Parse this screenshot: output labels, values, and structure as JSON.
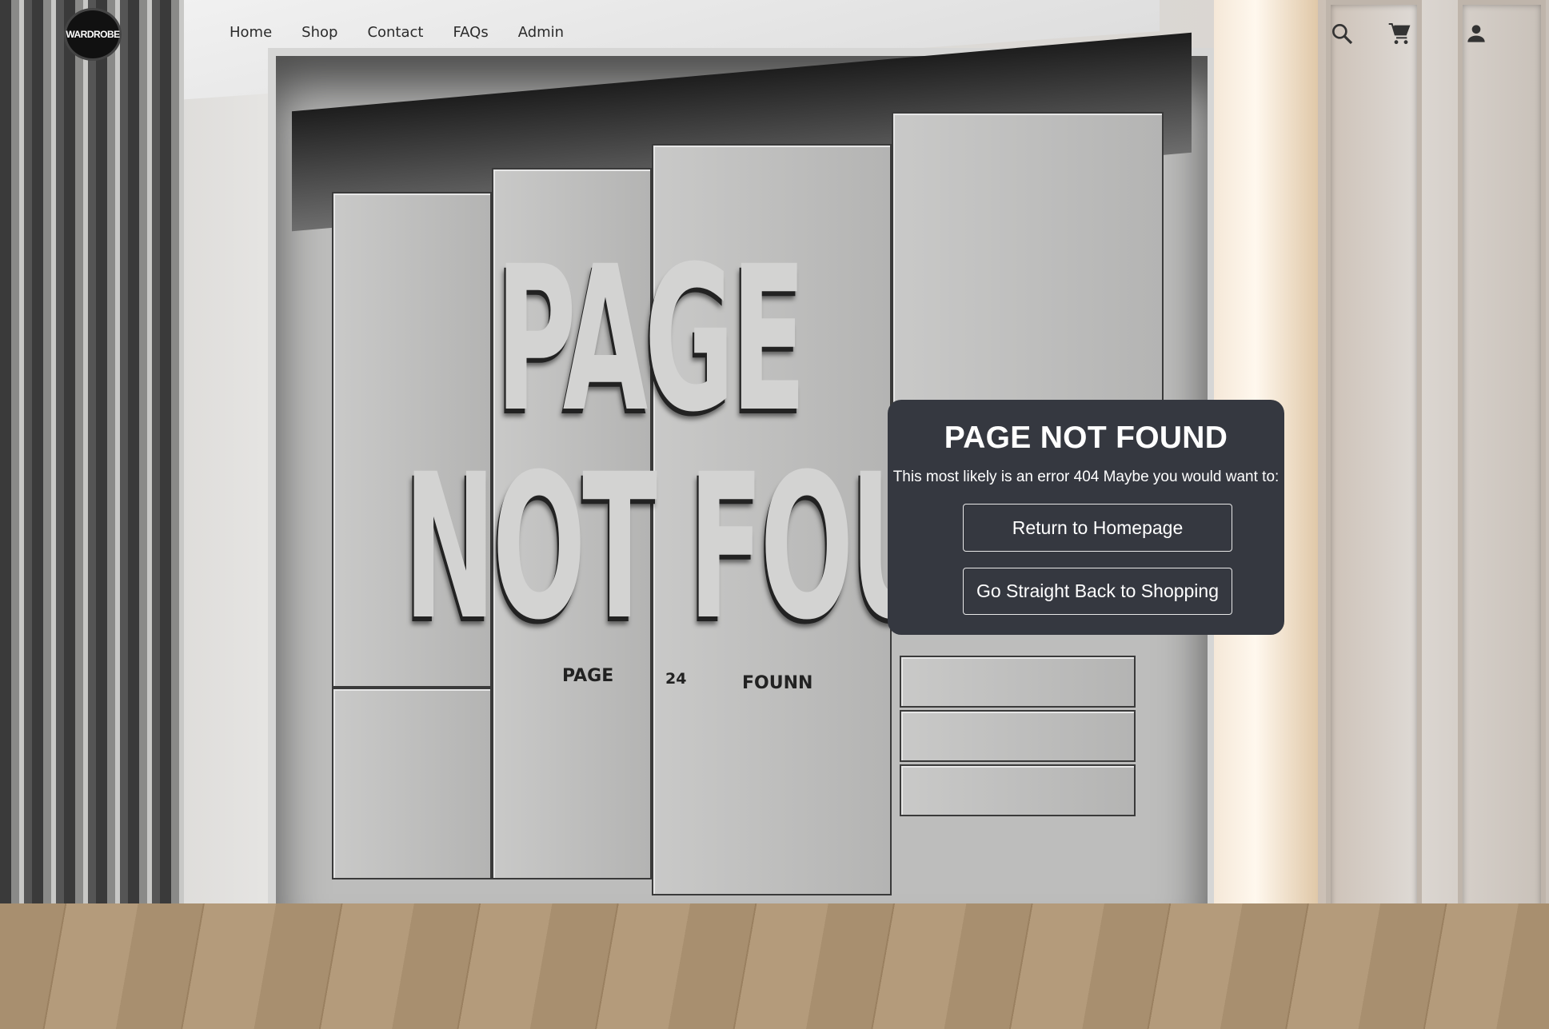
{
  "brand": {
    "logo_text": "WARDROBE"
  },
  "nav": {
    "items": [
      {
        "label": "Home"
      },
      {
        "label": "Shop"
      },
      {
        "label": "Contact"
      },
      {
        "label": "FAQs"
      },
      {
        "label": "Admin"
      }
    ]
  },
  "header_icons": [
    "search-icon",
    "cart-icon",
    "account-icon"
  ],
  "background_lettering": {
    "line1": "PAGE",
    "line2": "NOT FOUN",
    "plaque1": "PAGE",
    "plaque2": "24",
    "plaque3": "FOUNN"
  },
  "dialog": {
    "title": "PAGE NOT FOUND",
    "message": "This most likely is an error 404 Maybe you would want to:",
    "buttons": [
      {
        "label": "Return to Homepage"
      },
      {
        "label": "Go Straight Back to Shopping"
      }
    ],
    "background_color": "#353840"
  }
}
